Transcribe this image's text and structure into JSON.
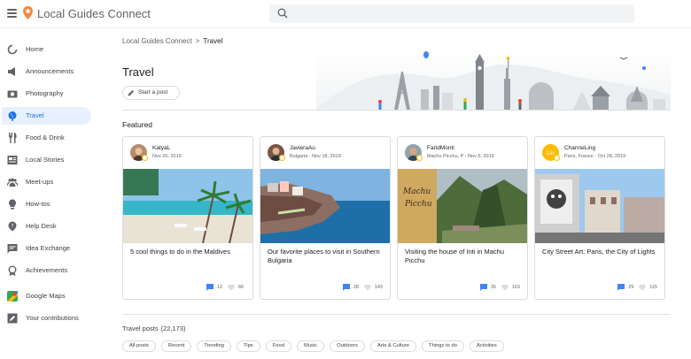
{
  "app": {
    "title": "Local Guides Connect"
  },
  "search": {
    "placeholder": ""
  },
  "sidebar": {
    "items": [
      {
        "label": "Home",
        "icon": "home-icon"
      },
      {
        "label": "Announcements",
        "icon": "megaphone-icon"
      },
      {
        "label": "Photography",
        "icon": "camera-icon"
      },
      {
        "label": "Travel",
        "icon": "globe-icon",
        "active": true
      },
      {
        "label": "Food & Drink",
        "icon": "fork-knife-icon"
      },
      {
        "label": "Local Stories",
        "icon": "news-icon"
      },
      {
        "label": "Meet-ups",
        "icon": "people-icon"
      },
      {
        "label": "How-tos",
        "icon": "lightbulb-icon"
      },
      {
        "label": "Help Desk",
        "icon": "help-icon"
      },
      {
        "label": "Idea Exchange",
        "icon": "chat-icon"
      },
      {
        "label": "Achievements",
        "icon": "badge-icon"
      },
      {
        "label": "Google Maps",
        "icon": "maps-icon"
      },
      {
        "label": "Your contributions",
        "icon": "edit-icon"
      }
    ]
  },
  "breadcrumb": {
    "root": "Local Guides Connect",
    "separator": ">",
    "current": "Travel"
  },
  "page": {
    "title": "Travel",
    "start_post": "Start a post"
  },
  "featured": {
    "heading": "Featured",
    "cards": [
      {
        "author": "KatyaL",
        "meta": "Nov 20, 2019",
        "title": "5 cool things to do in the Maldives",
        "comments": "12",
        "likes": "66"
      },
      {
        "author": "JavieraAu",
        "meta": "Bulgaria - Nov 18, 2019",
        "title": "Our favorite places to visit in Southern Bulgaria",
        "comments": "28",
        "likes": "143"
      },
      {
        "author": "FaridMonti",
        "meta": "Machu Picchu, P - Nov 5, 2019",
        "title": "Visiting the house of Inti in Machu Picchu",
        "comments": "35",
        "likes": "163"
      },
      {
        "author": "ChanneLing",
        "meta": "Paris, France - Oct 28, 2019",
        "title": "City Street Art: Paris, the City of Lights",
        "comments": "29",
        "likes": "115"
      }
    ]
  },
  "travel_posts": {
    "label": "Travel posts",
    "count": "(22,173)",
    "filters": [
      "All posts",
      "Recent",
      "Trending",
      "Tips",
      "Food",
      "Music",
      "Outdoors",
      "Arts & Culture",
      "Things to do",
      "Activities"
    ]
  },
  "colors": {
    "accent": "#1a73e8",
    "active_bg": "#e8f0fe",
    "logo": "#ea4335"
  }
}
